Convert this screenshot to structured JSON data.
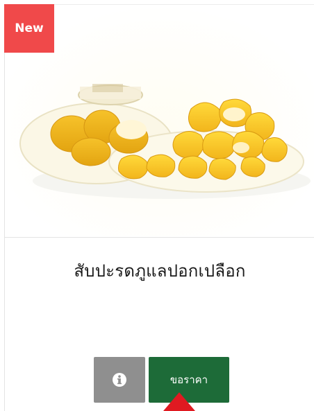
{
  "badge": {
    "label": "New",
    "color": "#f0494a"
  },
  "product": {
    "title": "สับปะรดภูแลปอกเปลือก",
    "image_alt": "peeled pineapple pieces in a clear plastic container"
  },
  "actions": {
    "info_icon": "info-icon",
    "quote_label": "ขอราคา",
    "quote_color": "#1d6b38",
    "info_color": "#8f8f8f"
  },
  "pointer_color": "#e01a21"
}
